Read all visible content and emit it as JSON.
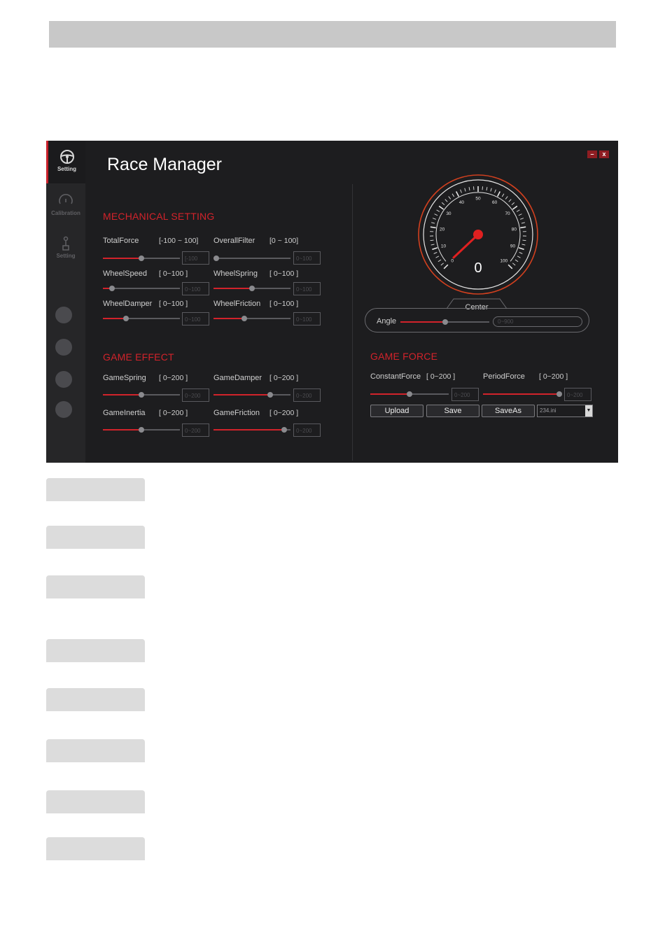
{
  "app": {
    "title": "Race Manager",
    "minimize_label": "–",
    "close_label": "x",
    "accent_color": "#d2232b"
  },
  "sidebar": {
    "items": [
      {
        "label": "Setting",
        "icon": "steering-wheel-icon",
        "active": true
      },
      {
        "label": "Calibration",
        "icon": "gauge-icon",
        "active": false
      },
      {
        "label": "Setting",
        "icon": "gear-shifter-icon",
        "active": false
      }
    ]
  },
  "mechanical": {
    "heading": "MECHANICAL SETTING",
    "total_force": {
      "label": "TotalForce",
      "range": "[-100 ~ 100]",
      "value_text": "[-100",
      "level": 0.5
    },
    "overall_filter": {
      "label": "OverallFilter",
      "range": "[0 ~ 100]",
      "value_text": "0~100",
      "level": 0.04
    },
    "wheel_speed": {
      "label": "WheelSpeed",
      "range": "[ 0~100 ]",
      "value_text": "0~100",
      "level": 0.12
    },
    "wheel_spring": {
      "label": "WheelSpring",
      "range": "[ 0~100 ]",
      "value_text": "0~100",
      "level": 0.5
    },
    "wheel_damper": {
      "label": "WheelDamper",
      "range": "[ 0~100 ]",
      "value_text": "0~100",
      "level": 0.3
    },
    "wheel_friction": {
      "label": "WheelFriction",
      "range": "[ 0~100 ]",
      "value_text": "0~100",
      "level": 0.4
    }
  },
  "game_effect": {
    "heading": "GAME EFFECT",
    "game_spring": {
      "label": "GameSpring",
      "range": "[ 0~200 ]",
      "value_text": "0~200",
      "level": 0.5
    },
    "game_damper": {
      "label": "GameDamper",
      "range": "[ 0~200 ]",
      "value_text": "0~200",
      "level": 0.74
    },
    "game_inertia": {
      "label": "GameInertia",
      "range": "[ 0~200 ]",
      "value_text": "0~200",
      "level": 0.5
    },
    "game_friction": {
      "label": "GameFriction",
      "range": "[ 0~200 ]",
      "value_text": "0~200",
      "level": 0.92
    }
  },
  "gauge": {
    "ticks": [
      "0",
      "10",
      "20",
      "30",
      "40",
      "50",
      "60",
      "70",
      "80",
      "90",
      "100"
    ],
    "value": "0",
    "center_label": "Center",
    "angle_label": "Angle",
    "angle_value_text": "0~900",
    "angle_level": 0.5
  },
  "game_force": {
    "heading": "GAME FORCE",
    "constant_force": {
      "label": "ConstantForce",
      "range": "[ 0~200 ]",
      "value_text": "0~200",
      "level": 0.5
    },
    "period_force": {
      "label": "PeriodForce",
      "range": "[ 0~200 ]",
      "value_text": "0~200",
      "level": 0.97
    },
    "upload_label": "Upload",
    "save_label": "Save",
    "saveas_label": "SaveAs",
    "profile_selected": "234.ini"
  }
}
